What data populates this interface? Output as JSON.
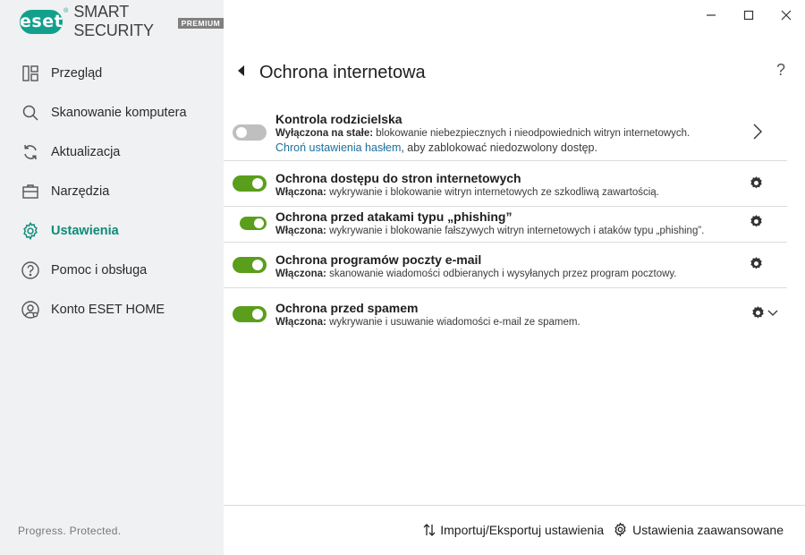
{
  "app": {
    "logo_text": "eset",
    "logo_reg": "®",
    "product_name": "SMART SECURITY",
    "edition": "PREMIUM",
    "tagline": "Progress. Protected.",
    "accent_color": "#12a08c",
    "toggle_on_color": "#5a9e1b"
  },
  "window": {
    "minimize_icon": "minimize-icon",
    "maximize_icon": "maximize-icon",
    "close_icon": "close-icon"
  },
  "sidebar": {
    "items": [
      {
        "label": "Przegląd",
        "icon": "dashboard-icon",
        "active": false
      },
      {
        "label": "Skanowanie komputera",
        "icon": "search-icon",
        "active": false
      },
      {
        "label": "Aktualizacja",
        "icon": "refresh-icon",
        "active": false
      },
      {
        "label": "Narzędzia",
        "icon": "briefcase-icon",
        "active": false
      },
      {
        "label": "Ustawienia",
        "icon": "gear-icon",
        "active": true
      },
      {
        "label": "Pomoc i obsługa",
        "icon": "help-icon",
        "active": false
      },
      {
        "label": "Konto ESET HOME",
        "icon": "account-icon",
        "active": false
      }
    ]
  },
  "header": {
    "title": "Ochrona internetowa",
    "help": "?"
  },
  "modules": [
    {
      "title": "Kontrola rodzicielska",
      "status_label": "Wyłączona na stałe:",
      "description": "blokowanie niebezpiecznych i nieodpowiednich witryn internetowych.",
      "link_text": "Chroń ustawienia hasłem",
      "link_suffix": ", aby zablokować niedozwolony dostęp.",
      "enabled": false,
      "action": "chevron-right-icon"
    },
    {
      "title": "Ochrona dostępu do stron internetowych",
      "status_label": "Włączona:",
      "description": "wykrywanie i blokowanie witryn internetowych ze szkodliwą zawartością.",
      "enabled": true,
      "action": "gear-icon"
    },
    {
      "title": "Ochrona przed atakami typu „phishing”",
      "status_label": "Włączona:",
      "description": "wykrywanie i blokowanie fałszywych witryn internetowych i ataków typu „phishing”.",
      "enabled": true,
      "action": "gear-icon"
    },
    {
      "title": "Ochrona programów poczty e-mail",
      "status_label": "Włączona:",
      "description": "skanowanie wiadomości odbieranych i wysyłanych przez program pocztowy.",
      "enabled": true,
      "action": "gear-icon"
    },
    {
      "title": "Ochrona przed spamem",
      "status_label": "Włączona:",
      "description": "wykrywanie i usuwanie wiadomości e-mail ze spamem.",
      "enabled": true,
      "action": "gear-chevron-icon"
    }
  ],
  "footer": {
    "import_export_label": "Importuj/Eksportuj ustawienia",
    "advanced_label": "Ustawienia zaawansowane"
  }
}
